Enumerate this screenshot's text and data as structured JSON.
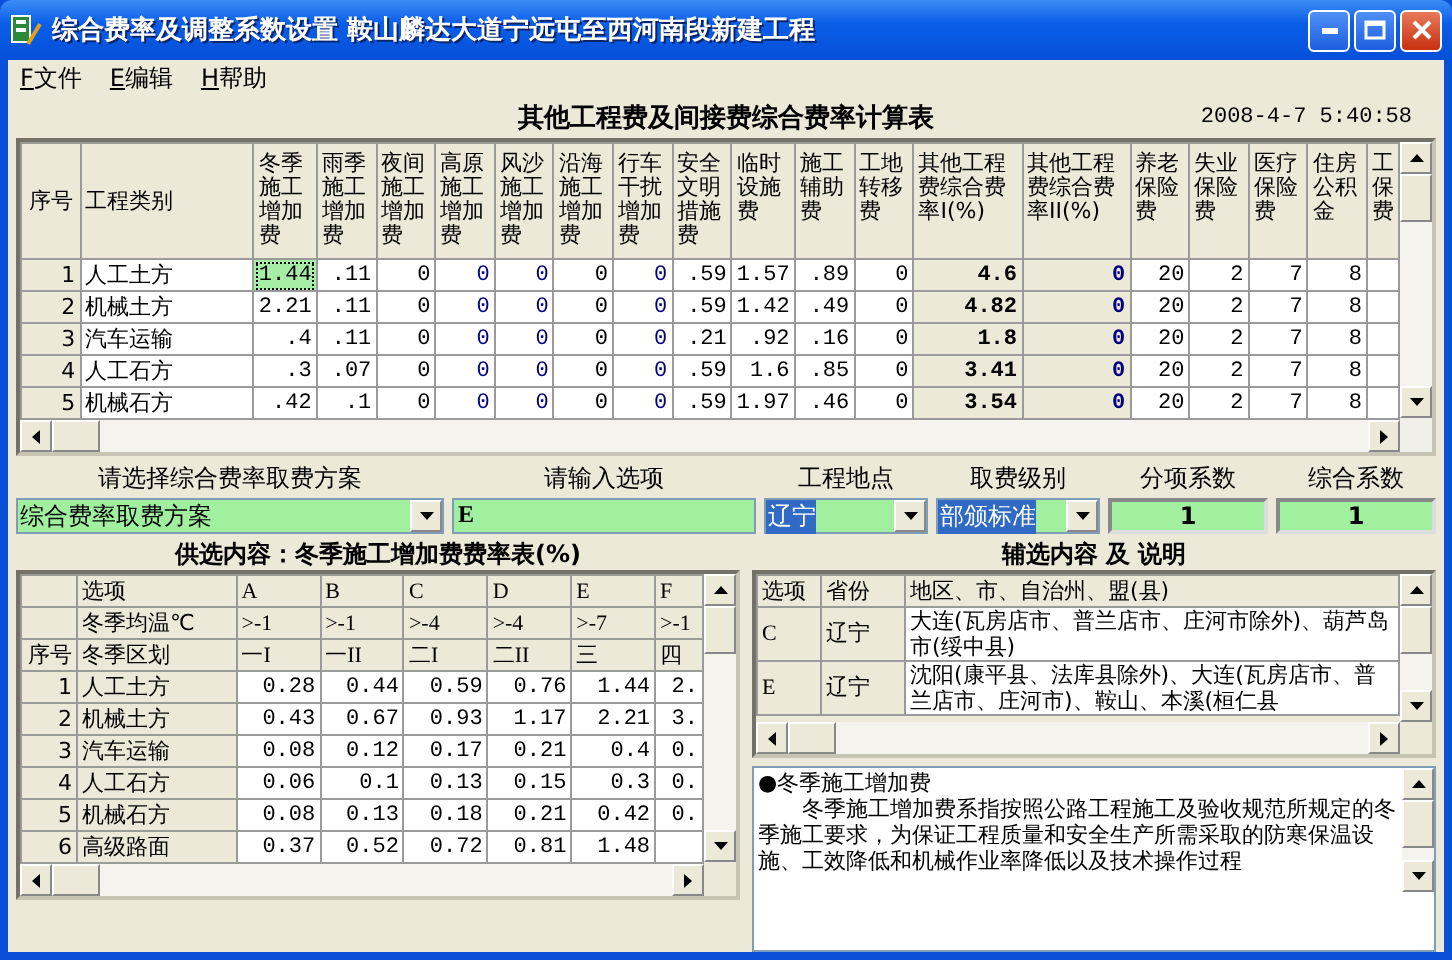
{
  "window": {
    "title": "综合费率及调整系数设置  鞍山麟达大道宁远屯至西河南段新建工程"
  },
  "menu": [
    {
      "hotkey": "F",
      "label": "文件"
    },
    {
      "hotkey": "E",
      "label": "编辑"
    },
    {
      "hotkey": "H",
      "label": "帮助"
    }
  ],
  "heading": {
    "title": "其他工程费及间接费综合费率计算表",
    "timestamp": "2008-4-7 5:40:58"
  },
  "main_table": {
    "number_header": "序号",
    "name_header": "工程类别",
    "columns": [
      {
        "label": "冬季施工增加费",
        "kind": "plain"
      },
      {
        "label": "雨季施工增加费",
        "kind": "plain"
      },
      {
        "label": "夜间施工增加费",
        "kind": "plain"
      },
      {
        "label": "高原施工增加费",
        "kind": "editable"
      },
      {
        "label": "风沙施工增加费",
        "kind": "editable"
      },
      {
        "label": "沿海施工增加费",
        "kind": "plain"
      },
      {
        "label": "行车干扰增加费",
        "kind": "editable"
      },
      {
        "label": "安全文明措施费",
        "kind": "plain"
      },
      {
        "label": "临时设施费",
        "kind": "plain"
      },
      {
        "label": "施工辅助费",
        "kind": "plain"
      },
      {
        "label": "工地转移费",
        "kind": "plain"
      },
      {
        "label": "其他工程费综合费率I(%)",
        "kind": "sum"
      },
      {
        "label": "其他工程费综合费率II(%)",
        "kind": "sum-editable"
      },
      {
        "label": "养老保险费",
        "kind": "plain"
      },
      {
        "label": "失业保险费",
        "kind": "plain"
      },
      {
        "label": "医疗保险费",
        "kind": "plain"
      },
      {
        "label": "住房公积金",
        "kind": "plain"
      },
      {
        "label": "工保费",
        "kind": "cut"
      }
    ],
    "rows": [
      {
        "number": "1",
        "name": "人工土方",
        "cells": [
          {
            "value": "1.44",
            "selected": true
          },
          {
            "value": ".11",
            "selected": false
          },
          {
            "value": "0",
            "selected": false
          },
          {
            "value": "0",
            "selected": false
          },
          {
            "value": "0",
            "selected": false
          },
          {
            "value": "0",
            "selected": false
          },
          {
            "value": "0",
            "selected": false
          },
          {
            "value": ".59",
            "selected": false
          },
          {
            "value": "1.57",
            "selected": false
          },
          {
            "value": ".89",
            "selected": false
          },
          {
            "value": "0",
            "selected": false
          },
          {
            "value": "4.6",
            "selected": false
          },
          {
            "value": "0",
            "selected": false
          },
          {
            "value": "20",
            "selected": false
          },
          {
            "value": "2",
            "selected": false
          },
          {
            "value": "7",
            "selected": false
          },
          {
            "value": "8",
            "selected": false
          }
        ]
      },
      {
        "number": "2",
        "name": "机械土方",
        "cells": [
          {
            "value": "2.21",
            "selected": false
          },
          {
            "value": ".11",
            "selected": false
          },
          {
            "value": "0",
            "selected": false
          },
          {
            "value": "0",
            "selected": false
          },
          {
            "value": "0",
            "selected": false
          },
          {
            "value": "0",
            "selected": false
          },
          {
            "value": "0",
            "selected": false
          },
          {
            "value": ".59",
            "selected": false
          },
          {
            "value": "1.42",
            "selected": false
          },
          {
            "value": ".49",
            "selected": false
          },
          {
            "value": "0",
            "selected": false
          },
          {
            "value": "4.82",
            "selected": false
          },
          {
            "value": "0",
            "selected": false
          },
          {
            "value": "20",
            "selected": false
          },
          {
            "value": "2",
            "selected": false
          },
          {
            "value": "7",
            "selected": false
          },
          {
            "value": "8",
            "selected": false
          }
        ]
      },
      {
        "number": "3",
        "name": "汽车运输",
        "cells": [
          {
            "value": ".4",
            "selected": false
          },
          {
            "value": ".11",
            "selected": false
          },
          {
            "value": "0",
            "selected": false
          },
          {
            "value": "0",
            "selected": false
          },
          {
            "value": "0",
            "selected": false
          },
          {
            "value": "0",
            "selected": false
          },
          {
            "value": "0",
            "selected": false
          },
          {
            "value": ".21",
            "selected": false
          },
          {
            "value": ".92",
            "selected": false
          },
          {
            "value": ".16",
            "selected": false
          },
          {
            "value": "0",
            "selected": false
          },
          {
            "value": "1.8",
            "selected": false
          },
          {
            "value": "0",
            "selected": false
          },
          {
            "value": "20",
            "selected": false
          },
          {
            "value": "2",
            "selected": false
          },
          {
            "value": "7",
            "selected": false
          },
          {
            "value": "8",
            "selected": false
          }
        ]
      },
      {
        "number": "4",
        "name": "人工石方",
        "cells": [
          {
            "value": ".3",
            "selected": false
          },
          {
            "value": ".07",
            "selected": false
          },
          {
            "value": "0",
            "selected": false
          },
          {
            "value": "0",
            "selected": false
          },
          {
            "value": "0",
            "selected": false
          },
          {
            "value": "0",
            "selected": false
          },
          {
            "value": "0",
            "selected": false
          },
          {
            "value": ".59",
            "selected": false
          },
          {
            "value": "1.6",
            "selected": false
          },
          {
            "value": ".85",
            "selected": false
          },
          {
            "value": "0",
            "selected": false
          },
          {
            "value": "3.41",
            "selected": false
          },
          {
            "value": "0",
            "selected": false
          },
          {
            "value": "20",
            "selected": false
          },
          {
            "value": "2",
            "selected": false
          },
          {
            "value": "7",
            "selected": false
          },
          {
            "value": "8",
            "selected": false
          }
        ]
      },
      {
        "number": "5",
        "name": "机械石方",
        "cells": [
          {
            "value": ".42",
            "selected": false
          },
          {
            "value": ".1",
            "selected": false
          },
          {
            "value": "0",
            "selected": false
          },
          {
            "value": "0",
            "selected": false
          },
          {
            "value": "0",
            "selected": false
          },
          {
            "value": "0",
            "selected": false
          },
          {
            "value": "0",
            "selected": false
          },
          {
            "value": ".59",
            "selected": false
          },
          {
            "value": "1.97",
            "selected": false
          },
          {
            "value": ".46",
            "selected": false
          },
          {
            "value": "0",
            "selected": false
          },
          {
            "value": "3.54",
            "selected": false
          },
          {
            "value": "0",
            "selected": false
          },
          {
            "value": "20",
            "selected": false
          },
          {
            "value": "2",
            "selected": false
          },
          {
            "value": "7",
            "selected": false
          },
          {
            "value": "8",
            "selected": false
          }
        ]
      }
    ]
  },
  "controls": [
    {
      "label": "请选择综合费率取费方案",
      "kind": "dropdown",
      "value": "综合费率取费方案",
      "highlighted": false
    },
    {
      "label": "请输入选项",
      "kind": "input",
      "value": "E"
    },
    {
      "label": "工程地点",
      "kind": "dropdown",
      "value": "辽宁",
      "highlighted": true
    },
    {
      "label": "取费级别",
      "kind": "dropdown",
      "value": "部颁标准",
      "highlighted": true
    },
    {
      "label": "分项系数",
      "kind": "number",
      "value": "1"
    },
    {
      "label": "综合系数",
      "kind": "number",
      "value": "1"
    }
  ],
  "rate_table": {
    "title": "供选内容：冬季施工增加费费率表(%)",
    "header_rows": [
      {
        "number": "",
        "name": "选项",
        "values": [
          "A",
          "B",
          "C",
          "D",
          "E",
          "F"
        ]
      },
      {
        "number": "",
        "name": "冬季均温℃",
        "values": [
          ">-1",
          ">-1",
          ">-4",
          ">-4",
          ">-7",
          ">-1"
        ]
      },
      {
        "number": "序号",
        "name": "冬季区划",
        "values": [
          "一I",
          "一II",
          "二I",
          "二II",
          "三",
          "四"
        ]
      }
    ],
    "rows": [
      {
        "number": "1",
        "name": "人工土方",
        "values": [
          "0.28",
          "0.44",
          "0.59",
          "0.76",
          "1.44",
          "2."
        ]
      },
      {
        "number": "2",
        "name": "机械土方",
        "values": [
          "0.43",
          "0.67",
          "0.93",
          "1.17",
          "2.21",
          "3."
        ]
      },
      {
        "number": "3",
        "name": "汽车运输",
        "values": [
          "0.08",
          "0.12",
          "0.17",
          "0.21",
          "0.4",
          "0."
        ]
      },
      {
        "number": "4",
        "name": "人工石方",
        "values": [
          "0.06",
          "0.1",
          "0.13",
          "0.15",
          "0.3",
          "0."
        ]
      },
      {
        "number": "5",
        "name": "机械石方",
        "values": [
          "0.08",
          "0.13",
          "0.18",
          "0.21",
          "0.42",
          "0."
        ]
      },
      {
        "number": "6",
        "name": "高级路面",
        "values": [
          "0.37",
          "0.52",
          "0.72",
          "0.81",
          "1.48"
        ]
      }
    ]
  },
  "region_table": {
    "title": "辅选内容 及 说明",
    "columns": [
      "选项",
      "省份",
      "地区、市、自治州、盟(县)"
    ],
    "rows": [
      {
        "option": "C",
        "province": "辽宁",
        "regions": "大连(瓦房店市、普兰店市、庄河市除外)、葫芦岛市(绥中县)"
      },
      {
        "option": "E",
        "province": "辽宁",
        "regions": "沈阳(康平县、法库县除外)、大连(瓦房店市、普兰店市、庄河市)、鞍山、本溪(桓仁县"
      }
    ]
  },
  "description": {
    "heading": "●冬季施工增加费",
    "text": "　　冬季施工增加费系指按照公路工程施工及验收规范所规定的冬季施工要求，为保证工程质量和安全生产所需采取的防寒保温设施、工效降低和机械作业率降低以及技术操作过程"
  }
}
